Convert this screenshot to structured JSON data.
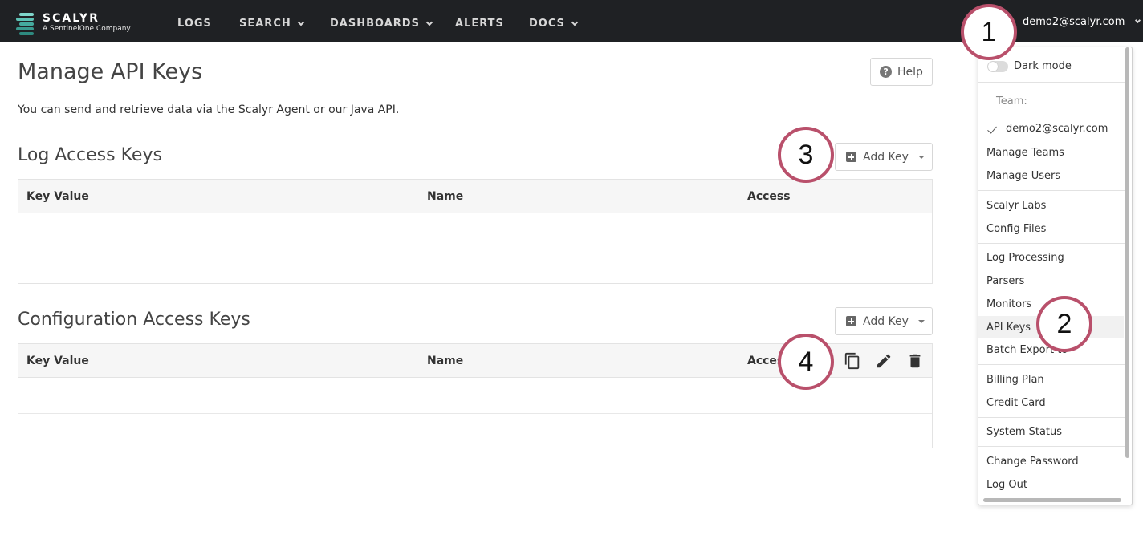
{
  "brand": {
    "name": "SCALYR",
    "tagline": "A SentinelOne Company",
    "bar_colors": [
      "#6fd1c6",
      "#49b5a8",
      "#2f8f86"
    ]
  },
  "nav": [
    {
      "label": "LOGS",
      "dropdown": false
    },
    {
      "label": "SEARCH",
      "dropdown": true
    },
    {
      "label": "DASHBOARDS",
      "dropdown": true
    },
    {
      "label": "ALERTS",
      "dropdown": false
    },
    {
      "label": "DOCS",
      "dropdown": true
    }
  ],
  "user": {
    "email": "demo2@scalyr.com"
  },
  "page": {
    "title": "Manage API Keys",
    "intro": "You can send and retrieve data via the Scalyr Agent or our Java API.",
    "help_label": "Help"
  },
  "log_section": {
    "title": "Log Access Keys",
    "add_label": "Add Key",
    "columns": [
      "Key Value",
      "Name",
      "Access"
    ]
  },
  "config_section": {
    "title": "Configuration Access Keys",
    "add_label": "Add Key",
    "columns": [
      "Key Value",
      "Name",
      "Access"
    ]
  },
  "row_actions": {
    "icons": [
      "copy-icon",
      "edit-icon",
      "delete-icon"
    ]
  },
  "menu": {
    "dark_mode_label": "Dark mode",
    "team_label": "Team:",
    "team_current": "demo2@scalyr.com",
    "groups": [
      [
        "Manage Teams",
        "Manage Users"
      ],
      [
        "Scalyr Labs",
        "Config Files"
      ],
      [
        "Log Processing",
        "Parsers",
        "Monitors",
        "API Keys",
        "Batch Export to"
      ],
      [
        "Billing Plan",
        "Credit Card"
      ],
      [
        "System Status"
      ],
      [
        "Change Password",
        "Log Out"
      ]
    ],
    "active_item": "API Keys"
  },
  "callouts": [
    "1",
    "2",
    "3",
    "4"
  ],
  "colors": {
    "topbar": "#1f2124",
    "callout_ring": "#b9506b"
  }
}
